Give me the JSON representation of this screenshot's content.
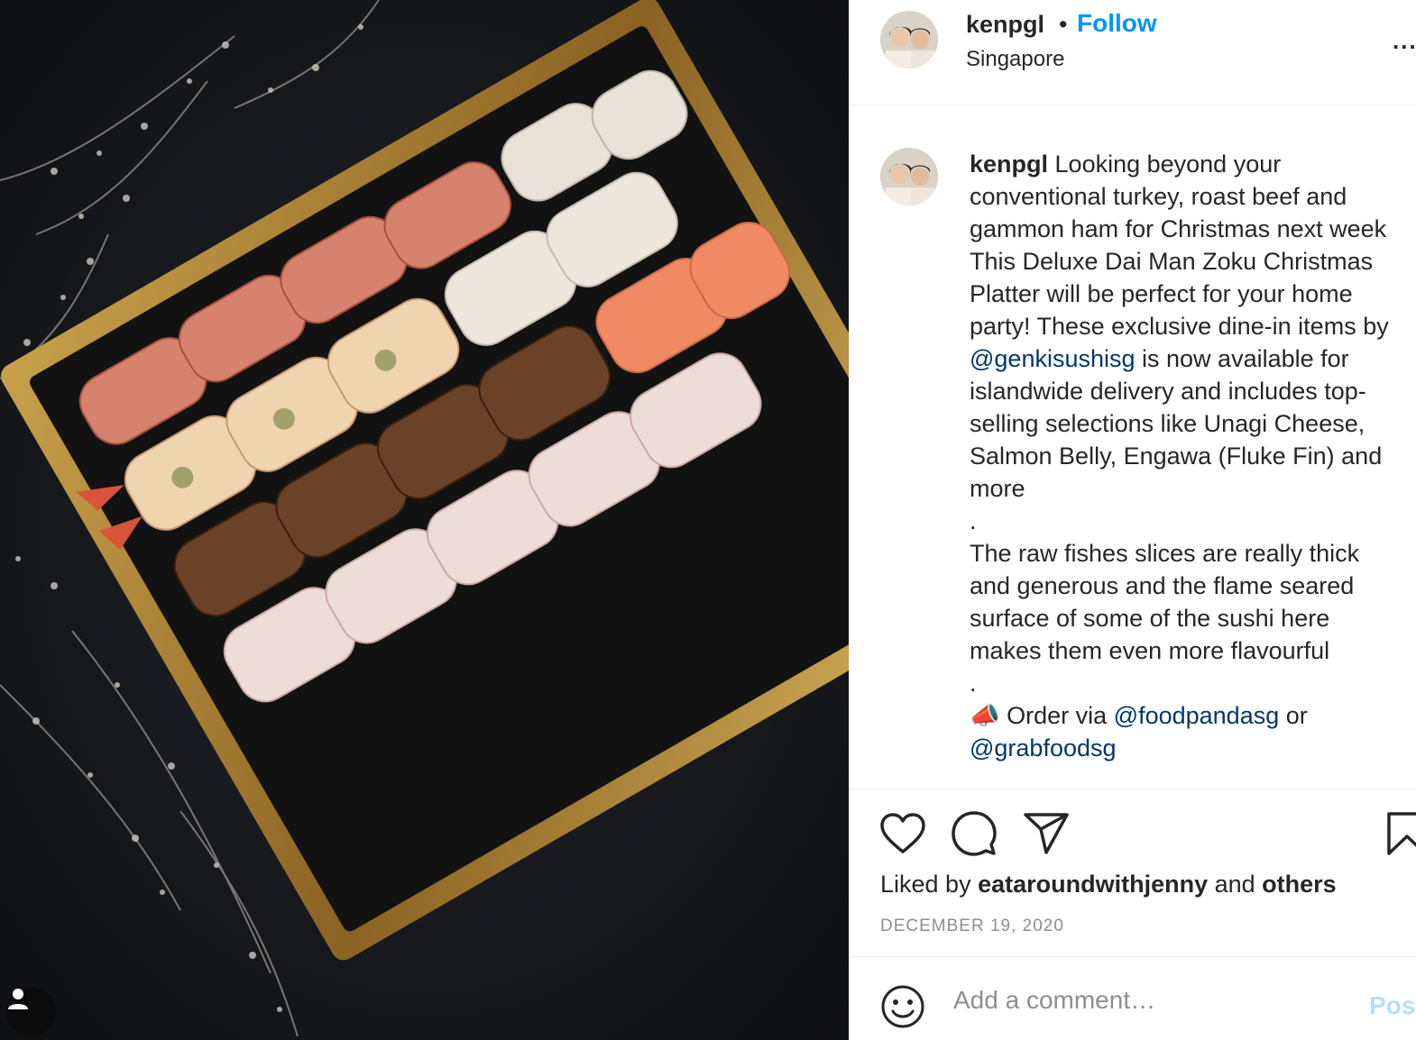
{
  "header": {
    "username": "kenpgl",
    "separator": "•",
    "follow_label": "Follow",
    "location": "Singapore",
    "more_label": "..."
  },
  "caption": {
    "username": "kenpgl",
    "lines": [
      "Looking beyond your",
      "conventional turkey, roast beef and",
      "gammon ham for Christmas next week",
      "This Deluxe Dai Man Zoku Christmas",
      "Platter will be perfect for your home",
      "party! These exclusive dine-in items by"
    ],
    "mention_genki": "@genkisushisg",
    "line_after_genki": " is now available for",
    "lines_b": [
      "islandwide delivery and includes top-",
      "selling selections like Unagi Cheese,",
      "Salmon Belly, Engawa (Fluke Fin) and",
      "more",
      "."
    ],
    "lines_c": [
      "The raw fishes slices are really thick",
      "and generous and the flame seared",
      "surface of some of the sushi here",
      "makes them even more flavourful",
      "."
    ],
    "order_icon": "📣",
    "order_text": " Order via ",
    "mention_foodpanda": "@foodpandasg",
    "or_text": " or",
    "mention_grabfood": "@grabfoodsg"
  },
  "actions": {
    "liked_by_prefix": "Liked by ",
    "liked_by_user": "eataroundwithjenny",
    "liked_by_mid": " and ",
    "liked_by_others": "others",
    "date": "DECEMBER 19, 2020"
  },
  "comment": {
    "placeholder": "Add a comment…",
    "post_label": "Post"
  },
  "icons": {
    "like": "heart-icon",
    "comment": "comment-bubble-icon",
    "share": "paper-plane-icon",
    "save": "bookmark-icon",
    "emoji": "smiley-icon",
    "tag": "user-tag-icon"
  },
  "colors": {
    "link_blue": "#0095f6",
    "mention": "#00376b",
    "muted": "#8e8e8e",
    "post_disabled": "#b2dffc"
  }
}
